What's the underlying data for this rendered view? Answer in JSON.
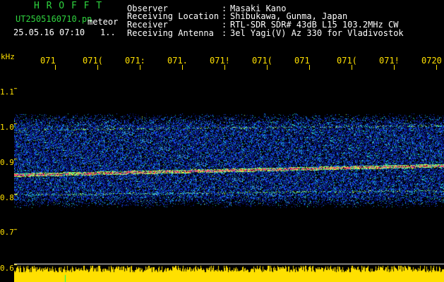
{
  "header": {
    "brand": "H R O F F T",
    "filename": "UT2505160710.pn",
    "mode": "meteor",
    "datetime": "25.05.16 07:10",
    "counter": "1.."
  },
  "info": {
    "labels": [
      "Observer",
      "Receiving Location",
      "Receiver",
      "Receiving Antenna"
    ],
    "colons": [
      ":",
      ":",
      ":",
      ":"
    ],
    "values": [
      "Masaki Kano",
      "Shibukawa, Gunma, Japan",
      "RTL-SDR SDR# 43dB L15 103.2MHz CW",
      "3el Yagi(V) Az 330 for Vladivostok"
    ]
  },
  "axis": {
    "unit": "kHz",
    "freq_ticks": [
      "1.1",
      "1.0",
      "0.9",
      "0.8",
      "0.7",
      "0.6"
    ],
    "time_ticks": [
      "071",
      "071(",
      "071:",
      "071.",
      "071!",
      "071(",
      "071",
      "071(",
      "071!",
      "0720"
    ]
  },
  "colors": {
    "background": "#000000",
    "green": "#2fd43f",
    "yellow": "#ffe000",
    "echo": "#ff3a6e",
    "noise_blue": "#1a3cff"
  }
}
